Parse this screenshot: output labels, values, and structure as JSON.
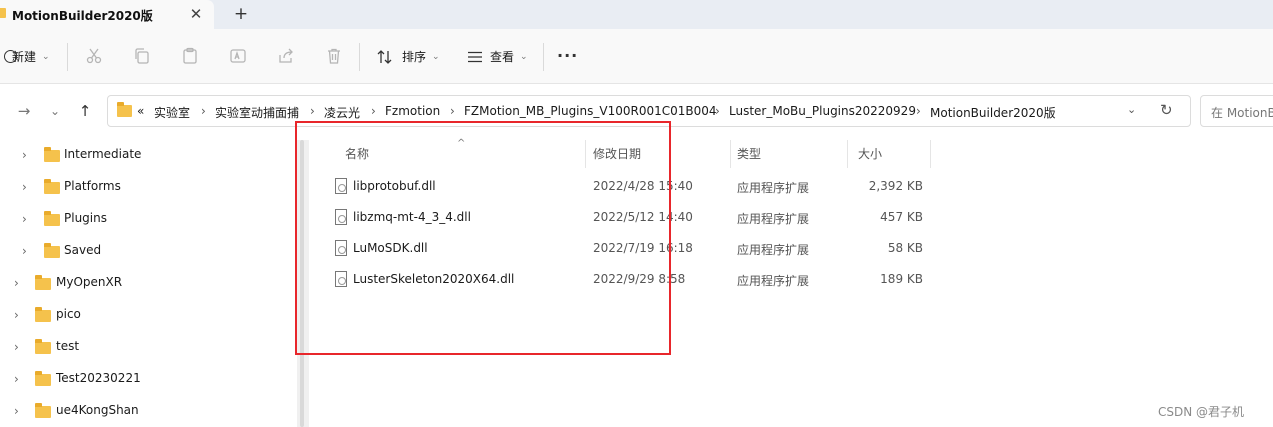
{
  "tab": {
    "title": "MotionBuilder2020版",
    "close_glyph": "✕",
    "new_glyph": "+"
  },
  "toolbar": {
    "new_label": "新建",
    "sort_label": "排序",
    "view_label": "查看",
    "more_glyph": "···",
    "caret_glyph": "⌄"
  },
  "nav": {
    "forward_glyph": "→",
    "recent_glyph": "⌄",
    "up_glyph": "↑"
  },
  "address": {
    "overflow_glyph": "«",
    "chevron_glyph": "›",
    "crumbs": [
      "实验室",
      "实验室动捕面捕",
      "凌云光",
      "Fzmotion",
      "FZMotion_MB_Plugins_V100R001C01B004",
      "Luster_MoBu_Plugins20220929",
      "MotionBuilder2020版"
    ],
    "dropdown_glyph": "⌄",
    "refresh_glyph": "↻"
  },
  "search": {
    "placeholder": "在 MotionB"
  },
  "sidebar": {
    "chevron_glyph": "›",
    "items": [
      {
        "label": "Intermediate"
      },
      {
        "label": "Platforms"
      },
      {
        "label": "Plugins"
      },
      {
        "label": "Saved"
      },
      {
        "label": "MyOpenXR"
      },
      {
        "label": "pico"
      },
      {
        "label": "test"
      },
      {
        "label": "Test20230221"
      },
      {
        "label": "ue4KongShan"
      }
    ]
  },
  "columns": {
    "name": "名称",
    "modified": "修改日期",
    "type": "类型",
    "size": "大小",
    "sort_glyph": "^"
  },
  "files": [
    {
      "name": "libprotobuf.dll",
      "modified": "2022/4/28 15:40",
      "type": "应用程序扩展",
      "size": "2,392 KB"
    },
    {
      "name": "libzmq-mt-4_3_4.dll",
      "modified": "2022/5/12 14:40",
      "type": "应用程序扩展",
      "size": "457 KB"
    },
    {
      "name": "LuMoSDK.dll",
      "modified": "2022/7/19 16:18",
      "type": "应用程序扩展",
      "size": "58 KB"
    },
    {
      "name": "LusterSkeleton2020X64.dll",
      "modified": "2022/9/29 8:58",
      "type": "应用程序扩展",
      "size": "189 KB"
    }
  ],
  "watermark": "CSDN @君子机",
  "colors": {
    "folder": "#f5c24c",
    "highlight_box": "#e8262b",
    "tabstrip": "#e9edf3"
  }
}
